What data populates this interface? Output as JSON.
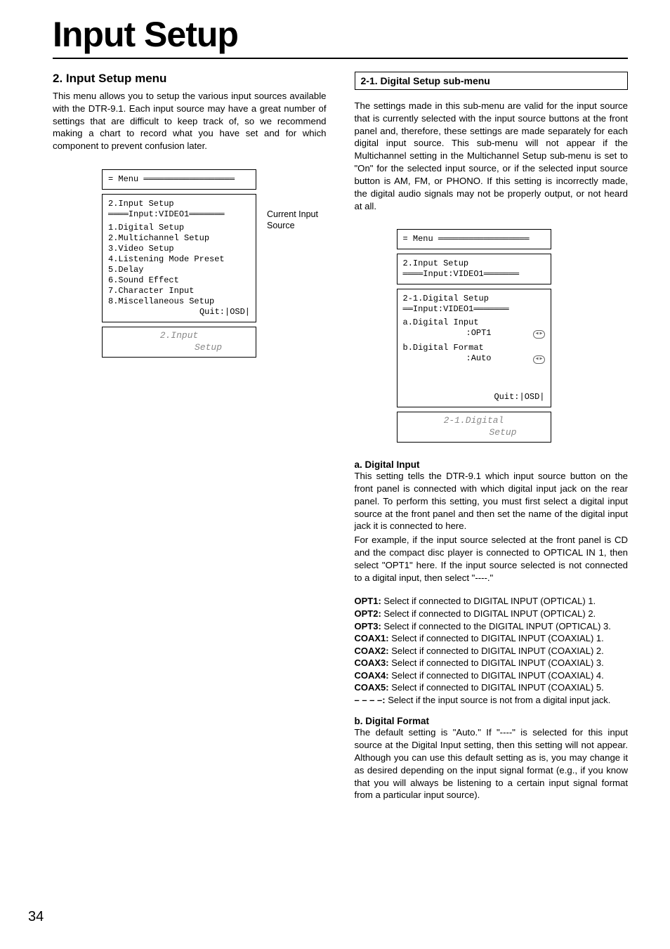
{
  "page_title": "Input Setup",
  "page_number": "34",
  "left": {
    "heading": "2. Input Setup menu",
    "intro": "This menu allows you to setup the various input sources available with the DTR-9.1. Each input source may have a great number of settings that are difficult to keep track of, so we recommend making a chart to record what you have set and for which component to prevent confusion later.",
    "osd": {
      "menu_label": "= Menu ══════════════════",
      "subtitle": "2.Input Setup",
      "input_line": "════Input:VIDEO1═══════",
      "items": [
        "1.Digital Setup",
        "2.Multichannel Setup",
        "3.Video Setup",
        "4.Listening Mode Preset",
        "5.Delay",
        "6.Sound Effect",
        "7.Character Input",
        "8.Miscellaneous Setup"
      ],
      "quit": "Quit:|OSD|"
    },
    "lcd_line1": "2.Input",
    "lcd_line2": "Setup",
    "side_label": "Current Input Source"
  },
  "right": {
    "sub_heading": "2-1. Digital Setup sub-menu",
    "intro": "The settings made in this sub-menu are valid for the input source that is currently selected with the input source buttons at the front panel and, therefore, these settings are made separately for each digital input source. This sub-menu will not appear if the Multichannel setting in the Multichannel Setup sub-menu is set to \"On\" for the selected input source, or if the selected input source button is AM, FM, or PHONO. If this setting is incorrectly made, the digital audio signals may not be properly output, or not heard at all.",
    "osd": {
      "menu_label": "= Menu ══════════════════",
      "subtitle": "2.Input Setup",
      "input_line": "════Input:VIDEO1═══════",
      "section": "2-1.Digital Setup",
      "section_input": "══Input:VIDEO1═══════",
      "item_a": "a.Digital Input",
      "val_a": ":OPT1",
      "item_b": "b.Digital Format",
      "val_b": ":Auto",
      "quit": "Quit:|OSD|"
    },
    "lcd_line1": "2-1.Digital",
    "lcd_line2": "Setup",
    "a_head": "a. Digital Input",
    "a_p1": "This setting tells the DTR-9.1 which input source button on the front panel is connected with which digital input jack on the rear panel. To perform this setting, you must first select a digital input source at the front panel and then set the name of the digital input jack it is connected to here.",
    "a_p2": "For example, if the input source selected at the front panel is CD and the compact disc player is connected to OPTICAL IN 1, then select \"OPT1\" here. If the input source selected is not connected to a digital input, then select \"----.\"",
    "opts": [
      {
        "k": "OPT1:",
        "v": " Select if connected to DIGITAL INPUT (OPTICAL) 1."
      },
      {
        "k": "OPT2:",
        "v": " Select if connected to DIGITAL INPUT (OPTICAL) 2."
      },
      {
        "k": "OPT3:",
        "v": " Select if connected to the DIGITAL INPUT (OPTICAL) 3."
      },
      {
        "k": "COAX1:",
        "v": " Select if connected to DIGITAL INPUT (COAXIAL) 1."
      },
      {
        "k": "COAX2:",
        "v": " Select if connected to DIGITAL INPUT (COAXIAL) 2."
      },
      {
        "k": "COAX3:",
        "v": " Select if connected to DIGITAL INPUT (COAXIAL) 3."
      },
      {
        "k": "COAX4:",
        "v": " Select if connected to DIGITAL INPUT (COAXIAL) 4."
      },
      {
        "k": "COAX5:",
        "v": " Select if connected to DIGITAL INPUT (COAXIAL) 5."
      },
      {
        "k": "– – – –:",
        "v": " Select if the input source is not from a digital input jack."
      }
    ],
    "b_head": "b. Digital Format",
    "b_p": "The default setting is \"Auto.\" If \"----\" is selected for this input source at the Digital Input setting, then this setting will not appear. Although you can use this default setting as is, you may change it as desired depending on the input signal format (e.g., if you know that you will always be listening to a certain input signal format from a particular input source)."
  }
}
